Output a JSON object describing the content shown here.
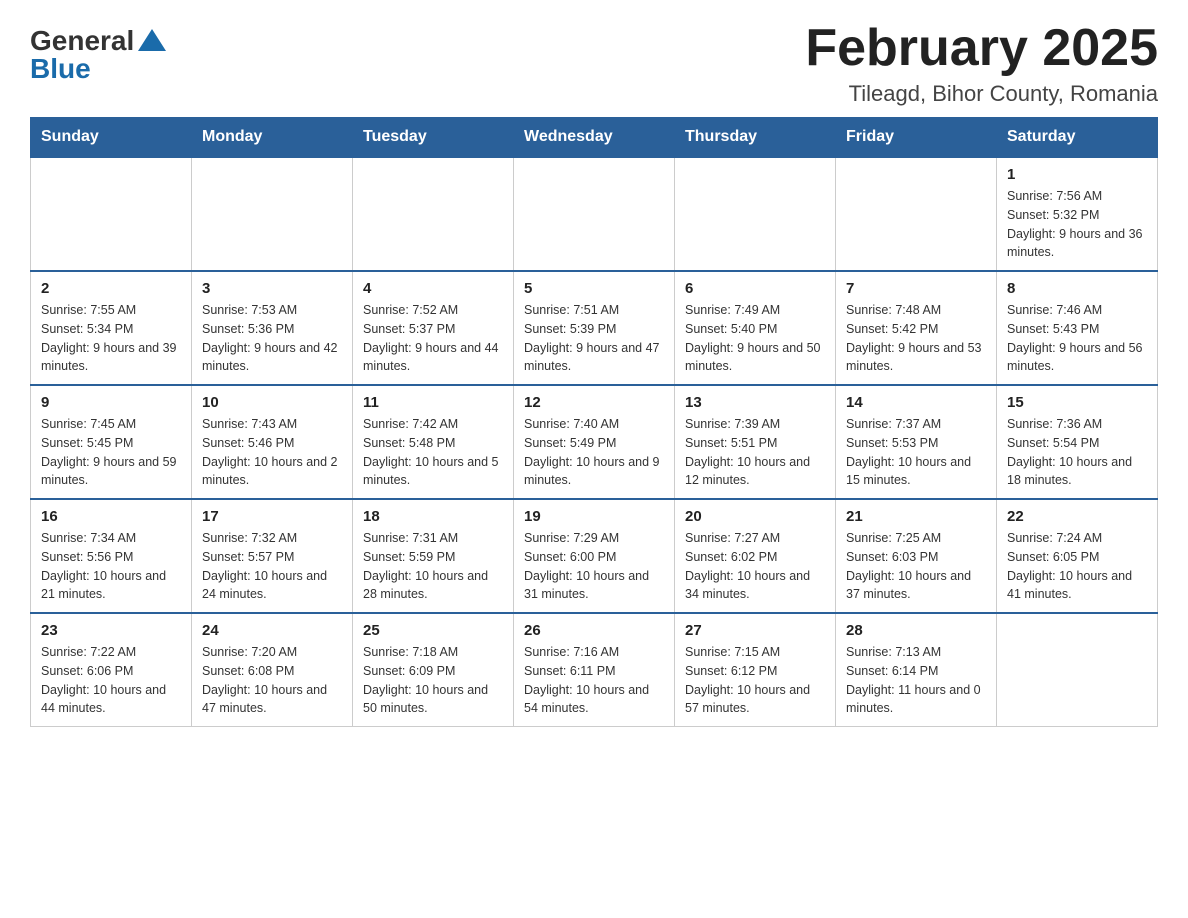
{
  "header": {
    "logo": {
      "general": "General",
      "blue": "Blue"
    },
    "title": "February 2025",
    "location": "Tileagd, Bihor County, Romania"
  },
  "calendar": {
    "days_of_week": [
      "Sunday",
      "Monday",
      "Tuesday",
      "Wednesday",
      "Thursday",
      "Friday",
      "Saturday"
    ],
    "weeks": [
      [
        {
          "day": "",
          "info": "",
          "empty": true
        },
        {
          "day": "",
          "info": "",
          "empty": true
        },
        {
          "day": "",
          "info": "",
          "empty": true
        },
        {
          "day": "",
          "info": "",
          "empty": true
        },
        {
          "day": "",
          "info": "",
          "empty": true
        },
        {
          "day": "",
          "info": "",
          "empty": true
        },
        {
          "day": "1",
          "info": "Sunrise: 7:56 AM\nSunset: 5:32 PM\nDaylight: 9 hours and 36 minutes.",
          "empty": false
        }
      ],
      [
        {
          "day": "2",
          "info": "Sunrise: 7:55 AM\nSunset: 5:34 PM\nDaylight: 9 hours and 39 minutes.",
          "empty": false
        },
        {
          "day": "3",
          "info": "Sunrise: 7:53 AM\nSunset: 5:36 PM\nDaylight: 9 hours and 42 minutes.",
          "empty": false
        },
        {
          "day": "4",
          "info": "Sunrise: 7:52 AM\nSunset: 5:37 PM\nDaylight: 9 hours and 44 minutes.",
          "empty": false
        },
        {
          "day": "5",
          "info": "Sunrise: 7:51 AM\nSunset: 5:39 PM\nDaylight: 9 hours and 47 minutes.",
          "empty": false
        },
        {
          "day": "6",
          "info": "Sunrise: 7:49 AM\nSunset: 5:40 PM\nDaylight: 9 hours and 50 minutes.",
          "empty": false
        },
        {
          "day": "7",
          "info": "Sunrise: 7:48 AM\nSunset: 5:42 PM\nDaylight: 9 hours and 53 minutes.",
          "empty": false
        },
        {
          "day": "8",
          "info": "Sunrise: 7:46 AM\nSunset: 5:43 PM\nDaylight: 9 hours and 56 minutes.",
          "empty": false
        }
      ],
      [
        {
          "day": "9",
          "info": "Sunrise: 7:45 AM\nSunset: 5:45 PM\nDaylight: 9 hours and 59 minutes.",
          "empty": false
        },
        {
          "day": "10",
          "info": "Sunrise: 7:43 AM\nSunset: 5:46 PM\nDaylight: 10 hours and 2 minutes.",
          "empty": false
        },
        {
          "day": "11",
          "info": "Sunrise: 7:42 AM\nSunset: 5:48 PM\nDaylight: 10 hours and 5 minutes.",
          "empty": false
        },
        {
          "day": "12",
          "info": "Sunrise: 7:40 AM\nSunset: 5:49 PM\nDaylight: 10 hours and 9 minutes.",
          "empty": false
        },
        {
          "day": "13",
          "info": "Sunrise: 7:39 AM\nSunset: 5:51 PM\nDaylight: 10 hours and 12 minutes.",
          "empty": false
        },
        {
          "day": "14",
          "info": "Sunrise: 7:37 AM\nSunset: 5:53 PM\nDaylight: 10 hours and 15 minutes.",
          "empty": false
        },
        {
          "day": "15",
          "info": "Sunrise: 7:36 AM\nSunset: 5:54 PM\nDaylight: 10 hours and 18 minutes.",
          "empty": false
        }
      ],
      [
        {
          "day": "16",
          "info": "Sunrise: 7:34 AM\nSunset: 5:56 PM\nDaylight: 10 hours and 21 minutes.",
          "empty": false
        },
        {
          "day": "17",
          "info": "Sunrise: 7:32 AM\nSunset: 5:57 PM\nDaylight: 10 hours and 24 minutes.",
          "empty": false
        },
        {
          "day": "18",
          "info": "Sunrise: 7:31 AM\nSunset: 5:59 PM\nDaylight: 10 hours and 28 minutes.",
          "empty": false
        },
        {
          "day": "19",
          "info": "Sunrise: 7:29 AM\nSunset: 6:00 PM\nDaylight: 10 hours and 31 minutes.",
          "empty": false
        },
        {
          "day": "20",
          "info": "Sunrise: 7:27 AM\nSunset: 6:02 PM\nDaylight: 10 hours and 34 minutes.",
          "empty": false
        },
        {
          "day": "21",
          "info": "Sunrise: 7:25 AM\nSunset: 6:03 PM\nDaylight: 10 hours and 37 minutes.",
          "empty": false
        },
        {
          "day": "22",
          "info": "Sunrise: 7:24 AM\nSunset: 6:05 PM\nDaylight: 10 hours and 41 minutes.",
          "empty": false
        }
      ],
      [
        {
          "day": "23",
          "info": "Sunrise: 7:22 AM\nSunset: 6:06 PM\nDaylight: 10 hours and 44 minutes.",
          "empty": false
        },
        {
          "day": "24",
          "info": "Sunrise: 7:20 AM\nSunset: 6:08 PM\nDaylight: 10 hours and 47 minutes.",
          "empty": false
        },
        {
          "day": "25",
          "info": "Sunrise: 7:18 AM\nSunset: 6:09 PM\nDaylight: 10 hours and 50 minutes.",
          "empty": false
        },
        {
          "day": "26",
          "info": "Sunrise: 7:16 AM\nSunset: 6:11 PM\nDaylight: 10 hours and 54 minutes.",
          "empty": false
        },
        {
          "day": "27",
          "info": "Sunrise: 7:15 AM\nSunset: 6:12 PM\nDaylight: 10 hours and 57 minutes.",
          "empty": false
        },
        {
          "day": "28",
          "info": "Sunrise: 7:13 AM\nSunset: 6:14 PM\nDaylight: 11 hours and 0 minutes.",
          "empty": false
        },
        {
          "day": "",
          "info": "",
          "empty": true
        }
      ]
    ]
  }
}
